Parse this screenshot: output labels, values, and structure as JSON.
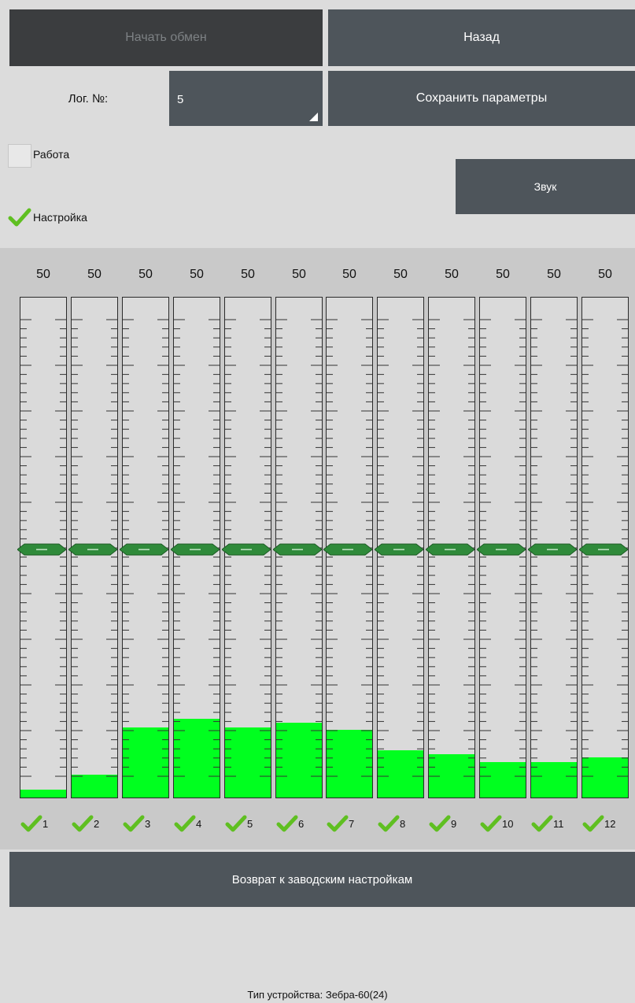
{
  "toolbar": {
    "start_label": "Начать обмен",
    "back_label": "Назад",
    "save_label": "Сохранить параметры",
    "sound_label": "Звук",
    "reset_label": "Возврат к заводским настройкам"
  },
  "log": {
    "label": "Лог. №:",
    "value": "5"
  },
  "modes": {
    "work": {
      "label": "Работа",
      "checked": false
    },
    "setup": {
      "label": "Настройка",
      "checked": true
    }
  },
  "channels": [
    {
      "label": "1",
      "setting": "50",
      "level": 0.016,
      "enabled": true
    },
    {
      "label": "2",
      "setting": "50",
      "level": 0.046,
      "enabled": true
    },
    {
      "label": "3",
      "setting": "50",
      "level": 0.14,
      "enabled": true
    },
    {
      "label": "4",
      "setting": "50",
      "level": 0.157,
      "enabled": true
    },
    {
      "label": "5",
      "setting": "50",
      "level": 0.14,
      "enabled": true
    },
    {
      "label": "6",
      "setting": "50",
      "level": 0.15,
      "enabled": true
    },
    {
      "label": "7",
      "setting": "50",
      "level": 0.135,
      "enabled": true
    },
    {
      "label": "8",
      "setting": "50",
      "level": 0.094,
      "enabled": true
    },
    {
      "label": "9",
      "setting": "50",
      "level": 0.087,
      "enabled": true
    },
    {
      "label": "10",
      "setting": "50",
      "level": 0.071,
      "enabled": true
    },
    {
      "label": "11",
      "setting": "50",
      "level": 0.071,
      "enabled": true
    },
    {
      "label": "12",
      "setting": "50",
      "level": 0.08,
      "enabled": true
    }
  ],
  "threshold_fraction": 0.5,
  "device": {
    "text": "Тип устройства: Зебра-60(24)"
  },
  "colors": {
    "accent": "#00ff1f",
    "button": "#4e555b",
    "check": "#5fbf21"
  }
}
